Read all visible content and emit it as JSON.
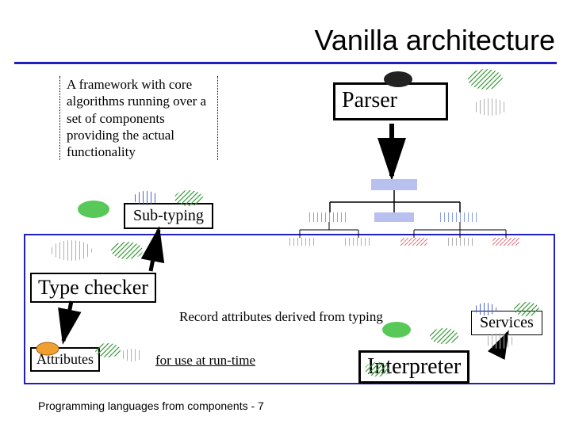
{
  "title": "Vanilla architecture",
  "framework_text": "A framework with core algorithms running over a set of components providing the actual functionality",
  "boxes": {
    "parser": "Parser",
    "subtyping": "Sub-typing",
    "typechecker": "Type checker",
    "attributes": "Attributes",
    "services": "Services",
    "interpreter": "Interpreter"
  },
  "annotations": {
    "record_text": "Record attributes derived from typing",
    "foruse_text": "for use at run-time"
  },
  "footer": "Programming languages from components - 7"
}
